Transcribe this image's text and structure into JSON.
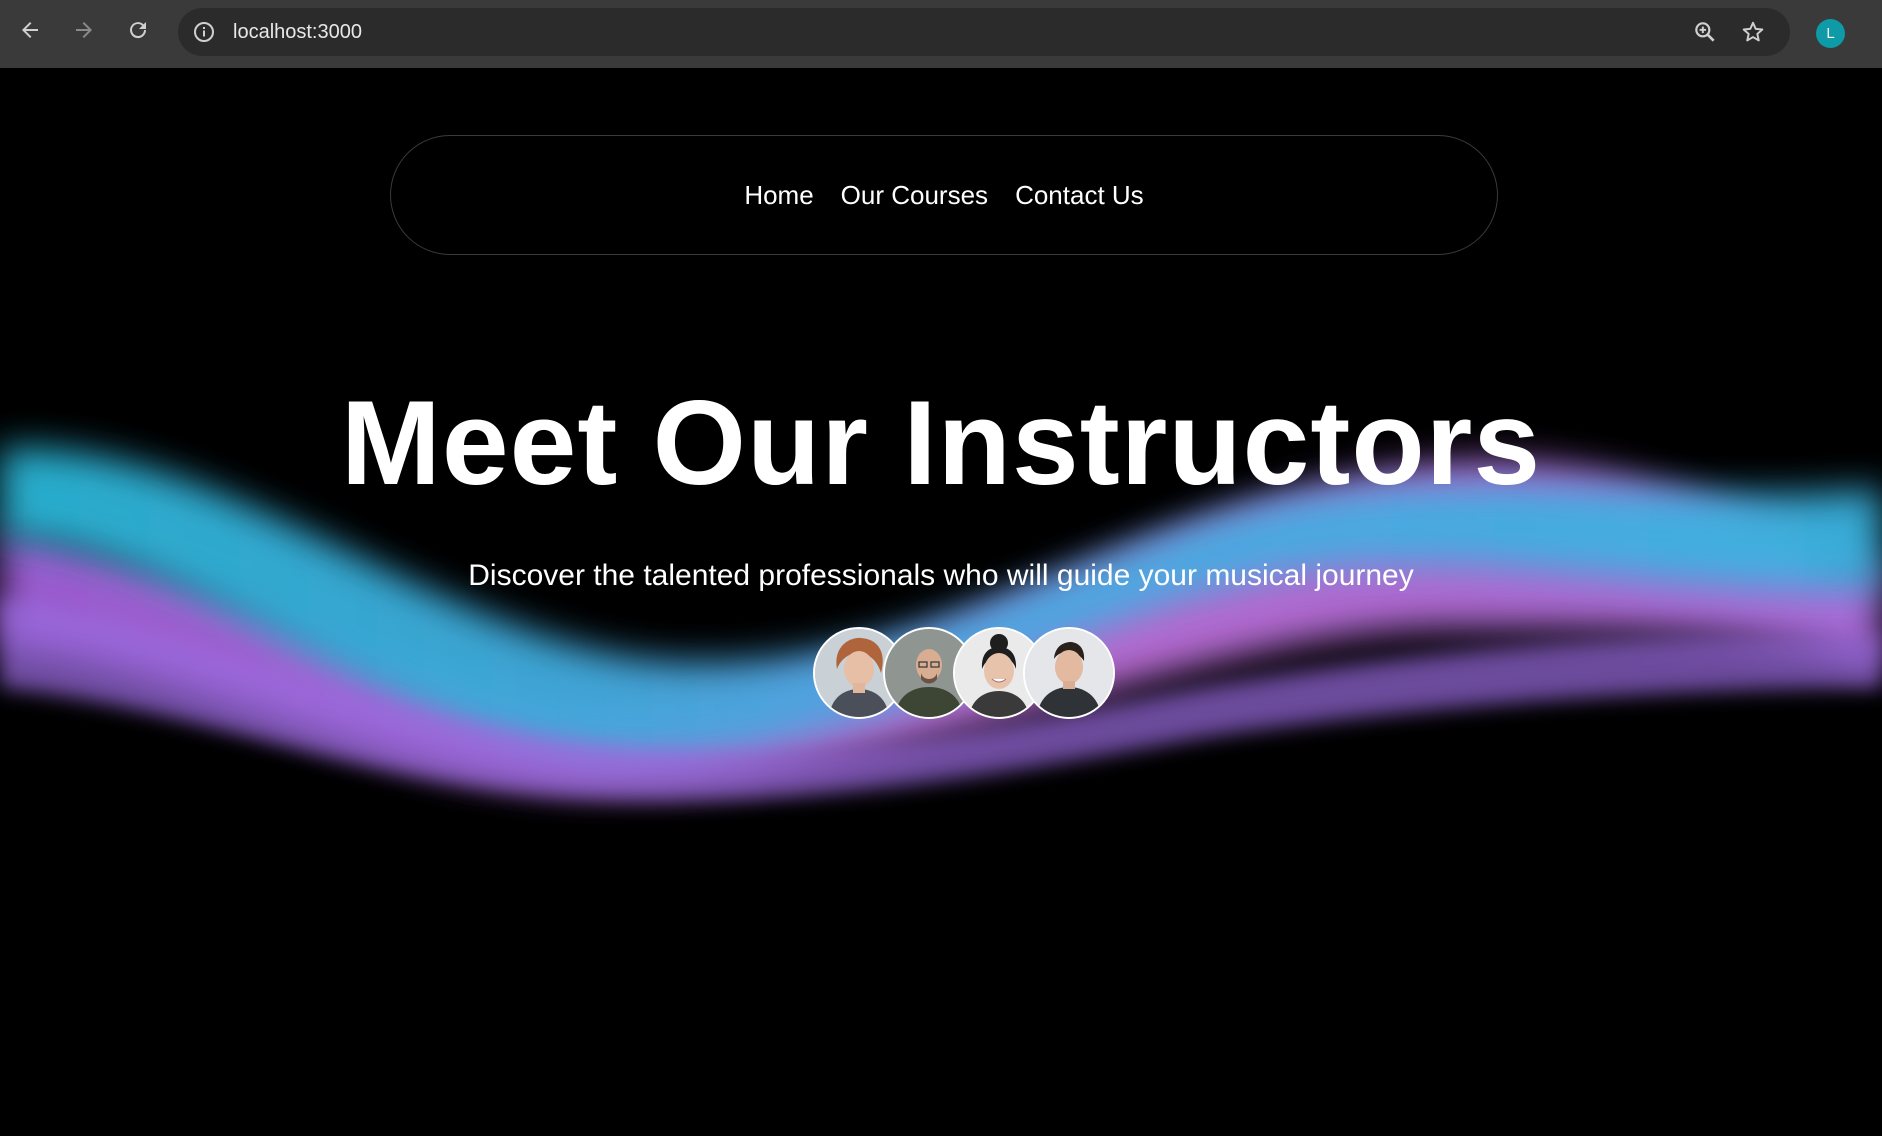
{
  "browser": {
    "url": "localhost:3000",
    "profile_initial": "L",
    "profile_color": "#0e9aa6",
    "icons": [
      "back-arrow-icon",
      "forward-arrow-icon",
      "reload-icon",
      "info-icon",
      "zoom-icon",
      "star-icon"
    ]
  },
  "nav": {
    "items": [
      {
        "label": "Home"
      },
      {
        "label": "Our Courses"
      },
      {
        "label": "Contact Us"
      }
    ]
  },
  "hero": {
    "title": "Meet Our Instructors",
    "subtitle": "Discover the talented professionals who will guide your musical journey",
    "wave_colors": [
      "#2ab8d8",
      "#5aa0e8",
      "#b070e0"
    ]
  },
  "instructors": [
    {
      "name": "instructor-1"
    },
    {
      "name": "instructor-2"
    },
    {
      "name": "instructor-3"
    },
    {
      "name": "instructor-4"
    }
  ]
}
